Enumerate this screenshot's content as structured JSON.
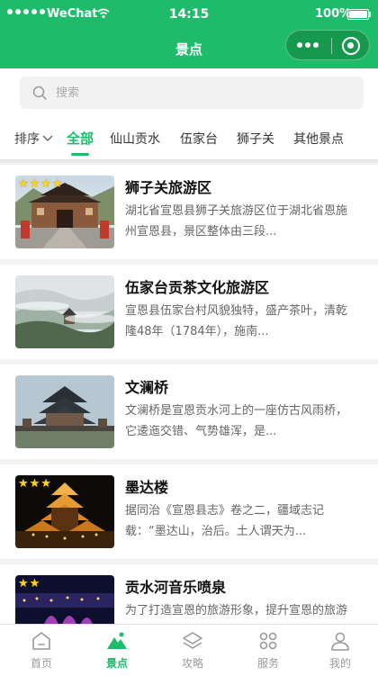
{
  "status_bar": {
    "carrier": "WeChat",
    "time": "14:15",
    "battery": "100%"
  },
  "header": {
    "title": "景点"
  },
  "search": {
    "placeholder": "搜索"
  },
  "filter": {
    "sort_label": "排序",
    "tabs": [
      "全部",
      "仙山贡水",
      "伍家台",
      "狮子关",
      "其他景点"
    ],
    "active_tab": "全部"
  },
  "spots": [
    {
      "title": "狮子关旅游区",
      "description": "湖北省宣恩县狮子关旅游区位于湖北省恩施州宣恩县，景区整体由三段...",
      "stars": "★★★★",
      "image": "gate-tower-photo"
    },
    {
      "title": "伍家台贡茶文化旅游区",
      "description": "宣恩县伍家台村风貌独特，盛产茶叶，清乾隆48年（1784年），施南...",
      "stars": "",
      "image": "misty-tea-hills-photo"
    },
    {
      "title": "文澜桥",
      "description": "文澜桥是宣恩贡水河上的一座仿古风雨桥，它逶迤交错、气势雄浑，是...",
      "stars": "",
      "image": "pagoda-bridge-photo"
    },
    {
      "title": "墨达楼",
      "description": "据同治《宣恩县志》卷之二，疆域志记载：“墨达山，治后。土人谓天为...",
      "stars": "★★★",
      "image": "night-tower-photo"
    },
    {
      "title": "贡水河音乐喷泉",
      "description": "为了打造宣恩的旅游形象，提升宣恩的旅游品位，推广宣恩的旅游资源...",
      "stars": "★★",
      "image": "fountain-night-photo"
    }
  ],
  "tabbar": {
    "items": [
      {
        "label": "首页",
        "icon": "home-icon"
      },
      {
        "label": "景点",
        "icon": "mountain-icon"
      },
      {
        "label": "攻略",
        "icon": "layers-icon"
      },
      {
        "label": "服务",
        "icon": "grid-icon"
      },
      {
        "label": "我的",
        "icon": "user-icon"
      }
    ],
    "active": "景点"
  },
  "colors": {
    "brand": "#1dbb6a",
    "star": "#ffd21f"
  }
}
